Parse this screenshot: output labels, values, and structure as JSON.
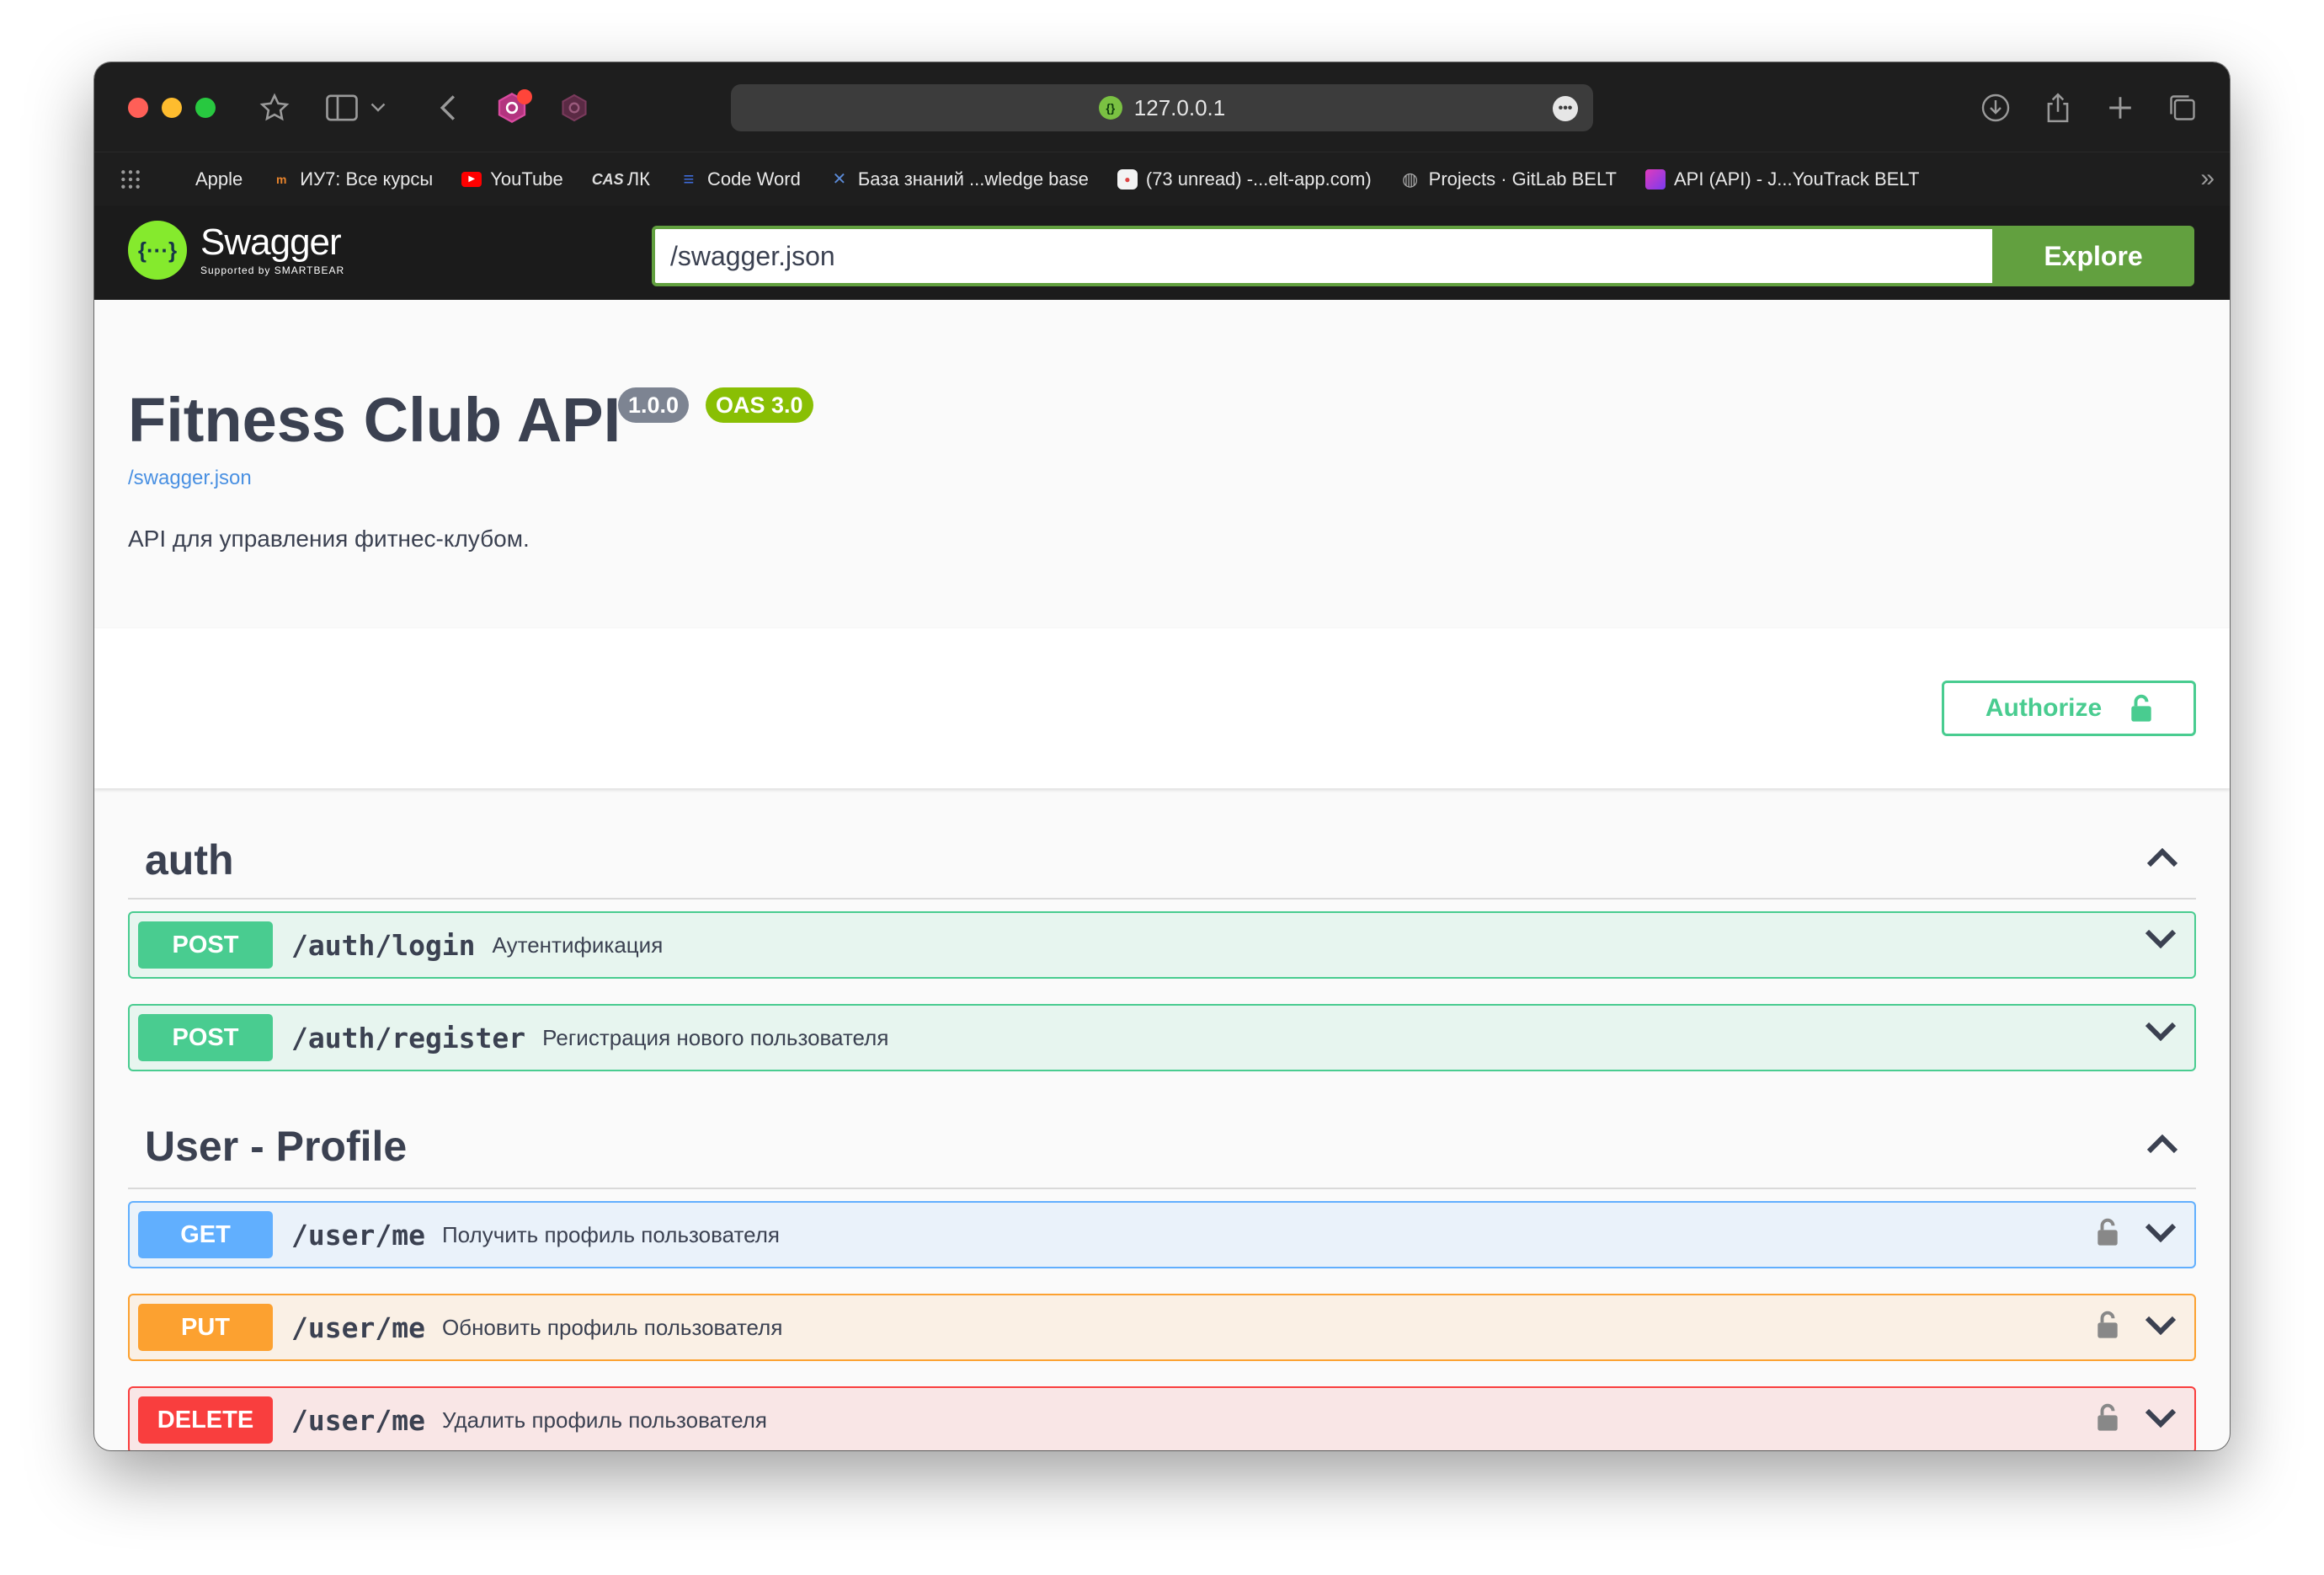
{
  "browser": {
    "url": "127.0.0.1",
    "bookmarks": [
      {
        "label": "Apple"
      },
      {
        "label": "ИУ7: Все курсы"
      },
      {
        "label": "YouTube"
      },
      {
        "label": "ЛК"
      },
      {
        "label": "Code Word"
      },
      {
        "label": "База знаний ...wledge base"
      },
      {
        "label": "(73 unread) -...elt-app.com)"
      },
      {
        "label": "Projects · GitLab BELT"
      },
      {
        "label": "API (API) - J...YouTrack BELT"
      }
    ]
  },
  "swagger": {
    "logo_text": "Swagger",
    "logo_sub": "Supported by SMARTBEAR",
    "url_value": "/swagger.json",
    "explore_label": "Explore"
  },
  "info": {
    "title": "Fitness Club API",
    "version": "1.0.0",
    "oas": "OAS 3.0",
    "spec_link": "/swagger.json",
    "description": "API для управления фитнес-клубом."
  },
  "authorize_label": "Authorize",
  "sections": [
    {
      "name": "auth",
      "operations": [
        {
          "method": "POST",
          "path": "/auth/login",
          "summary": "Аутентификация"
        },
        {
          "method": "POST",
          "path": "/auth/register",
          "summary": "Регистрация нового пользователя"
        }
      ]
    },
    {
      "name": "User - Profile",
      "operations": [
        {
          "method": "GET",
          "path": "/user/me",
          "summary": "Получить профиль пользователя"
        },
        {
          "method": "PUT",
          "path": "/user/me",
          "summary": "Обновить профиль пользователя"
        },
        {
          "method": "DELETE",
          "path": "/user/me",
          "summary": "Удалить профиль пользователя"
        }
      ]
    }
  ],
  "colors": {
    "post": "#49cc90",
    "get": "#61affe",
    "put": "#fca130",
    "delete": "#f93e3e",
    "explore": "#62a03f",
    "version_badge": "#7d8492",
    "oas_badge": "#89bf04"
  }
}
